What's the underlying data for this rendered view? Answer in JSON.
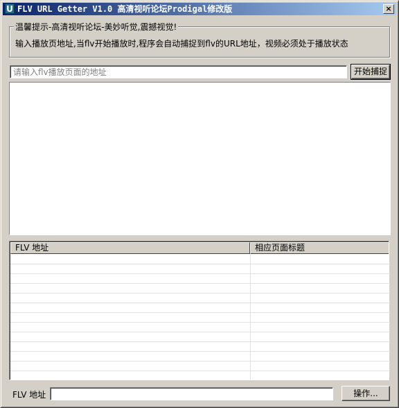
{
  "window": {
    "title": "FLV URL Getter V1.0 高清视听论坛Prodigal修改版",
    "app_icon_letter": "U",
    "close_glyph": "×"
  },
  "tips": {
    "legend": "温馨提示-高清视听论坛-美妙听觉,震撼视觉!",
    "text": "输入播放页地址,当flv开始播放时,程序会自动捕捉到flv的URL地址，视频必须处于播放状态"
  },
  "url_bar": {
    "placeholder": "请输入flv播放页面的地址",
    "value": "",
    "capture_button": "开始捕捉"
  },
  "list": {
    "columns": [
      "FLV 地址",
      "相应页面标题"
    ],
    "rows": []
  },
  "footer": {
    "label": "FLV 地址",
    "value": "",
    "action_button": "操作..."
  }
}
